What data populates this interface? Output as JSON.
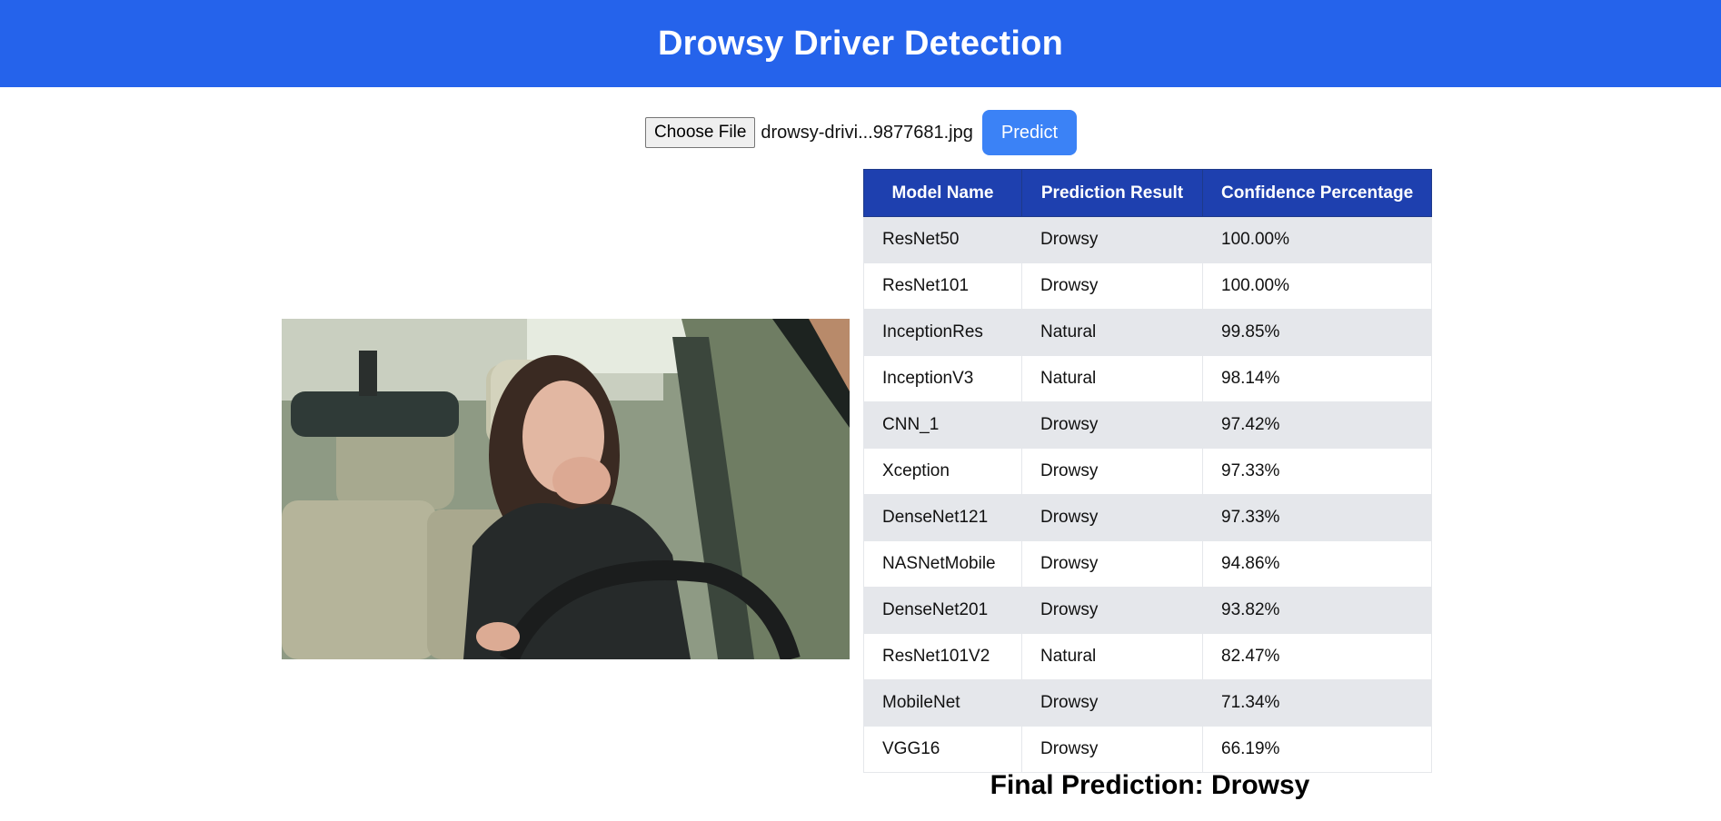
{
  "app": {
    "title": "Drowsy Driver Detection"
  },
  "colors": {
    "header": "#2563eb",
    "table_header": "#1e40af",
    "predict_button": "#3b82f6",
    "row_stripe": "#e5e7eb"
  },
  "upload": {
    "choose_label": "Choose File",
    "file_name": "drowsy-drivi...9877681.jpg",
    "predict_label": "Predict"
  },
  "image": {
    "icon": "driver-yawning-photo"
  },
  "table": {
    "headers": [
      "Model Name",
      "Prediction Result",
      "Confidence Percentage"
    ],
    "rows": [
      [
        "ResNet50",
        "Drowsy",
        "100.00%"
      ],
      [
        "ResNet101",
        "Drowsy",
        "100.00%"
      ],
      [
        "InceptionRes",
        "Natural",
        "99.85%"
      ],
      [
        "InceptionV3",
        "Natural",
        "98.14%"
      ],
      [
        "CNN_1",
        "Drowsy",
        "97.42%"
      ],
      [
        "Xception",
        "Drowsy",
        "97.33%"
      ],
      [
        "DenseNet121",
        "Drowsy",
        "97.33%"
      ],
      [
        "NASNetMobile",
        "Drowsy",
        "94.86%"
      ],
      [
        "DenseNet201",
        "Drowsy",
        "93.82%"
      ],
      [
        "ResNet101V2",
        "Natural",
        "82.47%"
      ],
      [
        "MobileNet",
        "Drowsy",
        "71.34%"
      ],
      [
        "VGG16",
        "Drowsy",
        "66.19%"
      ]
    ]
  },
  "final": {
    "text": "Final Prediction: Drowsy"
  }
}
